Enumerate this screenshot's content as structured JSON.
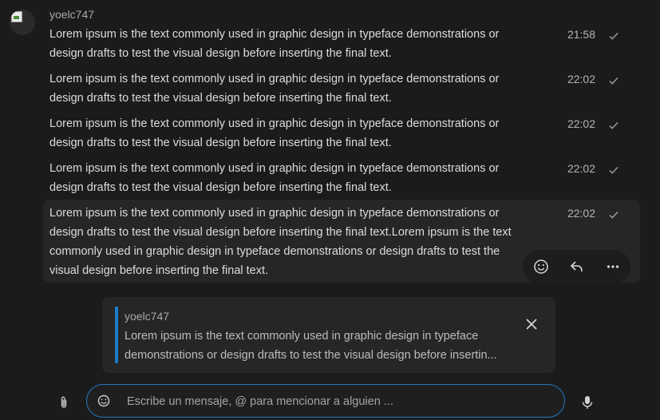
{
  "chat": {
    "sender": "yoelc747",
    "messages": [
      {
        "text": "Lorem ipsum is the text commonly used in graphic design in typeface demonstrations or design drafts to test the visual design before inserting the final text.",
        "time": "21:58"
      },
      {
        "text": "Lorem ipsum is the text commonly used in graphic design in typeface demonstrations or design drafts to test the visual design before inserting the final text.",
        "time": "22:02"
      },
      {
        "text": "Lorem ipsum is the text commonly used in graphic design in typeface demonstrations or design drafts to test the visual design before inserting the final text.",
        "time": "22:02"
      },
      {
        "text": "Lorem ipsum is the text commonly used in graphic design in typeface demonstrations or design drafts to test the visual design before inserting the final text.",
        "time": "22:02"
      },
      {
        "text": "Lorem ipsum is the text commonly used in graphic design in typeface demonstrations or design drafts to test the visual design before inserting the final text.Lorem ipsum is the text commonly used in graphic design in typeface demonstrations or design drafts to test the visual design before inserting the final text.",
        "time": "22:02"
      }
    ],
    "message_actions": [
      "emoji-icon",
      "reply-icon",
      "more-icon"
    ]
  },
  "reply_preview": {
    "author": "yoelc747",
    "text": "Lorem ipsum is the text commonly used in graphic design in typeface demonstrations or design drafts to test the visual design before insertin..."
  },
  "composer": {
    "placeholder": "Escribe un mensaje, @ para mencionar a alguien ...",
    "value": ""
  },
  "colors": {
    "background": "#1b1b1b",
    "accent": "#1e7bc8",
    "hover_row": "#262626"
  }
}
